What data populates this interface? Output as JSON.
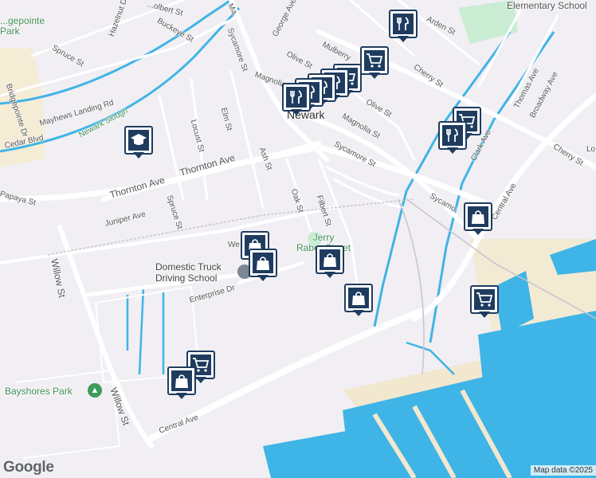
{
  "map": {
    "attribution": "Map data ©2025",
    "logo": "Google",
    "colors": {
      "land": "#f1eff3",
      "water": "#3fb4e6",
      "park": "#c9ecd2",
      "sand": "#f5ecd6",
      "road": "#ffffff",
      "marker": "#1f3c5f"
    }
  },
  "labels": {
    "elementary_school": "Elementary School",
    "park_topleft": "...gepointe\nPark",
    "arden_st": "Arden St",
    "cherry_st_top": "Cherry St",
    "cherry_st_right": "Cherry St",
    "george_ave": "George Ave",
    "olive_st_top": "Olive St",
    "mulberry": "Mulberry",
    "olive_st": "Olive St",
    "magnolia_st": "Magnolia St",
    "magnolia_st_left": "Magnolia S",
    "newark": "Newark",
    "sycamore_st_top": "Sycamore St",
    "sycamore_st_mid": "Sycamore St",
    "sycamore_st_right": "Sycamo",
    "thomas_ave": "Thomas Ave",
    "broadway_ave": "Broadway Ave",
    "clark_ave": "Clark Ave",
    "central_ave_right": "Central Ave",
    "central_ave_bottom": "Central Ave",
    "spruce_st_top": "Spruce St",
    "spruce_st": "Spruce St",
    "hazelnut_dr": "Hazelnut Dr",
    "buckeye_st": "Buckeye St",
    "bridgepointe_dr": "Bridgepointe Dr",
    "cedar_blvd": "Cedar Blvd",
    "mayhews_landing_rd": "Mayhews Landing Rd",
    "newark_slough": "Newark Slough",
    "locust_st": "Locust St",
    "elm_st": "Elm St",
    "ash_st": "Ash St",
    "thornton_ave_left": "Thornton Ave",
    "thornton_ave_right": "Thornton Ave",
    "papaya_st": "Papaya St",
    "juniper_ave": "Juniper Ave",
    "oak_st": "Oak St",
    "filbert_st": "Filbert St",
    "willow_st_left": "Willow St",
    "willow_st_bottom": "Willow St",
    "jerry_raber": "Jerry\nRaber Street",
    "domestic_truck": "Domestic Truck\nDriving School",
    "enterprise_dr": "Enterprise Dr",
    "we_partial": "We",
    "bayshores_park": "Bayshores Park",
    "dolbert_st": "...olbert St",
    "mark_partial": "Ma",
    "lo_partial": "Lo"
  },
  "markers": [
    {
      "name": "restaurant-marker",
      "icon": "fork-knife-icon"
    },
    {
      "name": "grocery-marker",
      "icon": "shopping-cart-icon"
    },
    {
      "name": "grocery-marker",
      "icon": "shopping-cart-icon"
    },
    {
      "name": "restaurant-marker",
      "icon": "fork-knife-icon"
    },
    {
      "name": "restaurant-marker",
      "icon": "fork-knife-icon"
    },
    {
      "name": "restaurant-marker",
      "icon": "fork-knife-icon"
    },
    {
      "name": "restaurant-marker",
      "icon": "fork-knife-icon"
    },
    {
      "name": "school-marker",
      "icon": "graduation-cap-icon"
    },
    {
      "name": "grocery-marker",
      "icon": "shopping-cart-icon"
    },
    {
      "name": "restaurant-marker",
      "icon": "fork-knife-icon"
    },
    {
      "name": "shopping-bag-marker",
      "icon": "shopping-bag-icon"
    },
    {
      "name": "shopping-bag-marker",
      "icon": "shopping-bag-icon"
    },
    {
      "name": "shopping-bag-marker",
      "icon": "shopping-bag-icon"
    },
    {
      "name": "shopping-bag-marker",
      "icon": "shopping-bag-icon"
    },
    {
      "name": "shopping-bag-marker",
      "icon": "shopping-bag-icon"
    },
    {
      "name": "grocery-marker",
      "icon": "shopping-cart-icon"
    },
    {
      "name": "grocery-marker",
      "icon": "shopping-cart-icon"
    },
    {
      "name": "shopping-bag-marker",
      "icon": "shopping-bag-icon"
    }
  ]
}
